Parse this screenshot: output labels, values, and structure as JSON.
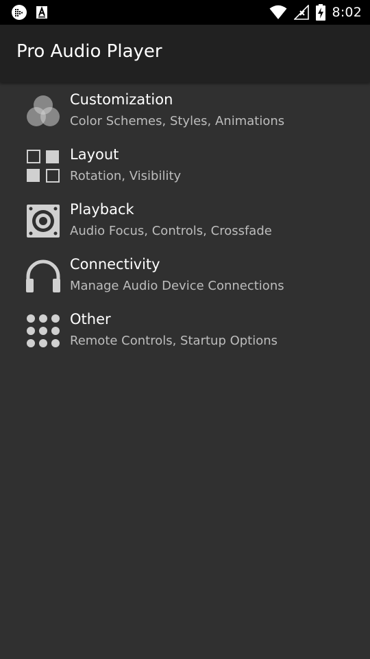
{
  "status_bar": {
    "time": "8:02",
    "left_icons": [
      "app-notification-icon",
      "a-notification-icon"
    ],
    "right_icons": [
      "wifi-icon",
      "no-signal-icon",
      "battery-charging-icon"
    ]
  },
  "app_bar": {
    "title": "Pro Audio Player"
  },
  "settings": {
    "items": [
      {
        "title": "Customization",
        "subtitle": "Color Schemes, Styles, Animations",
        "icon": "customization-icon"
      },
      {
        "title": "Layout",
        "subtitle": "Rotation, Visibility",
        "icon": "layout-icon"
      },
      {
        "title": "Playback",
        "subtitle": "Audio Focus, Controls, Crossfade",
        "icon": "speaker-icon"
      },
      {
        "title": "Connectivity",
        "subtitle": "Manage Audio Device Connections",
        "icon": "headphones-icon"
      },
      {
        "title": "Other",
        "subtitle": "Remote Controls, Startup Options",
        "icon": "dots-grid-icon"
      }
    ]
  },
  "colors": {
    "background": "#303030",
    "app_bar": "#212121",
    "status_bar": "#000000",
    "title_text": "#ffffff",
    "subtitle_text": "#bdbdbd",
    "icon": "#d0d0d0"
  }
}
